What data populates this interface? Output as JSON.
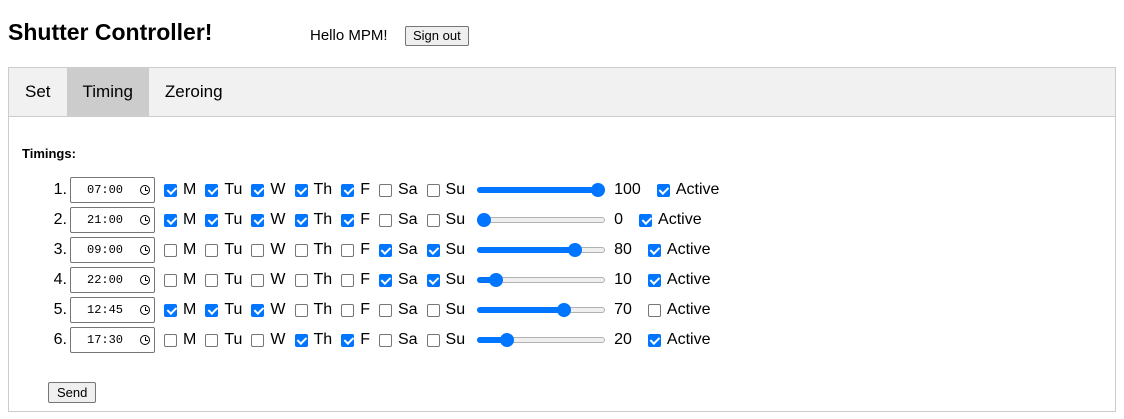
{
  "header": {
    "title": "Shutter Controller!",
    "greeting": "Hello MPM!",
    "signout_label": "Sign out"
  },
  "tabs": [
    {
      "label": "Set",
      "active": false
    },
    {
      "label": "Timing",
      "active": true
    },
    {
      "label": "Zeroing",
      "active": false
    }
  ],
  "timing": {
    "section_label": "Timings:",
    "day_labels": [
      "M",
      "Tu",
      "W",
      "Th",
      "F",
      "Sa",
      "Su"
    ],
    "active_label": "Active",
    "send_label": "Send",
    "rows": [
      {
        "index": "1.",
        "time": "07:00",
        "days": [
          true,
          true,
          true,
          true,
          true,
          false,
          false
        ],
        "level": 100,
        "active": true
      },
      {
        "index": "2.",
        "time": "21:00",
        "days": [
          true,
          true,
          true,
          true,
          true,
          false,
          false
        ],
        "level": 0,
        "active": true
      },
      {
        "index": "3.",
        "time": "09:00",
        "days": [
          false,
          false,
          false,
          false,
          false,
          true,
          true
        ],
        "level": 80,
        "active": true
      },
      {
        "index": "4.",
        "time": "22:00",
        "days": [
          false,
          false,
          false,
          false,
          false,
          true,
          true
        ],
        "level": 10,
        "active": true
      },
      {
        "index": "5.",
        "time": "12:45",
        "days": [
          true,
          true,
          true,
          false,
          false,
          false,
          false
        ],
        "level": 70,
        "active": false
      },
      {
        "index": "6.",
        "time": "17:30",
        "days": [
          false,
          false,
          false,
          true,
          true,
          false,
          false
        ],
        "level": 20,
        "active": true
      }
    ]
  },
  "colors": {
    "accent": "#0075ff",
    "tab_active_bg": "#cccccc",
    "tabbar_bg": "#f1f1f1"
  },
  "icons": {
    "time_picker": "clock-icon"
  }
}
